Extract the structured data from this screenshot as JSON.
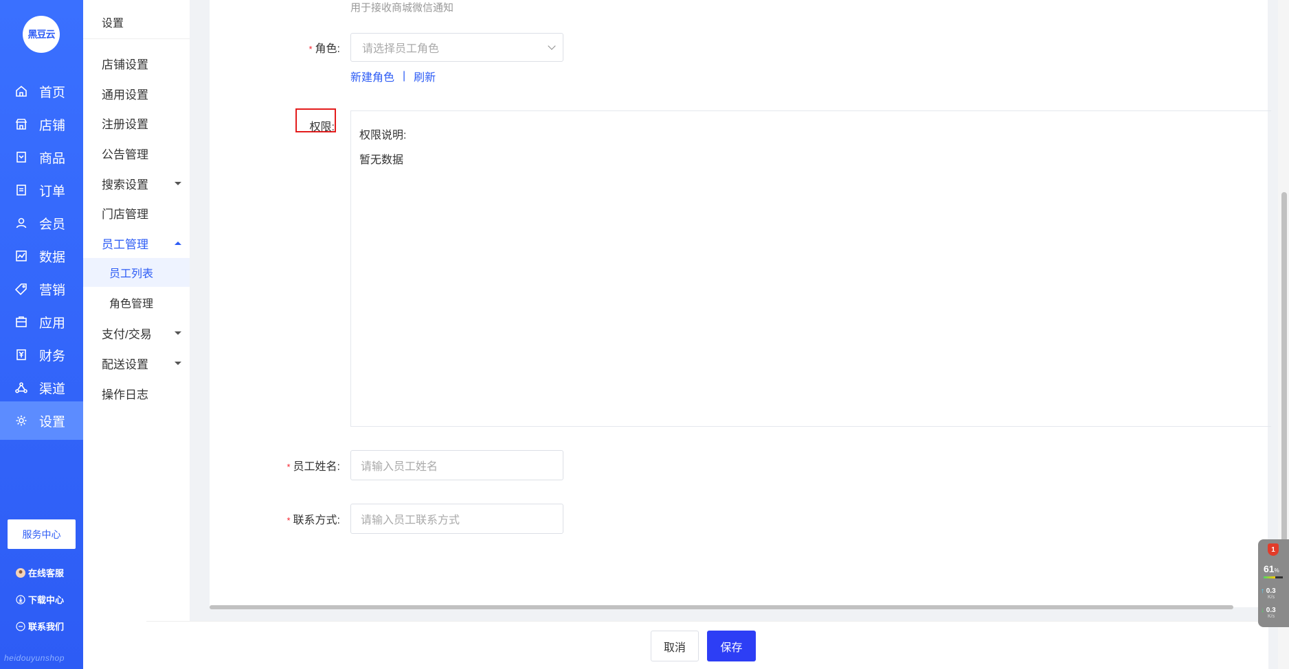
{
  "brand": {
    "logo_text": "黑豆云",
    "footer_text": "heidouyunshop"
  },
  "nav": [
    {
      "label": "首页",
      "icon": "home-icon"
    },
    {
      "label": "店铺",
      "icon": "store-icon"
    },
    {
      "label": "商品",
      "icon": "product-icon"
    },
    {
      "label": "订单",
      "icon": "order-icon"
    },
    {
      "label": "会员",
      "icon": "member-icon"
    },
    {
      "label": "数据",
      "icon": "data-icon"
    },
    {
      "label": "营销",
      "icon": "tag-icon"
    },
    {
      "label": "应用",
      "icon": "app-icon"
    },
    {
      "label": "财务",
      "icon": "finance-icon"
    },
    {
      "label": "渠道",
      "icon": "channel-icon"
    },
    {
      "label": "设置",
      "icon": "gear-icon"
    }
  ],
  "service": {
    "center_label": "服务中心",
    "online_label": "在线客服",
    "download_label": "下载中心",
    "contact_label": "联系我们"
  },
  "submenu": {
    "title": "设置",
    "items": [
      "店铺设置",
      "通用设置",
      "注册设置",
      "公告管理",
      "搜索设置",
      "门店管理",
      "员工管理"
    ],
    "staff_children": [
      "员工列表",
      "角色管理"
    ],
    "more": [
      "支付/交易",
      "配送设置",
      "操作日志"
    ]
  },
  "form": {
    "wechat_hint": "用于接收商城微信通知",
    "role_label": "角色:",
    "role_placeholder": "请选择员工角色",
    "new_role_link": "新建角色",
    "link_separator": "|",
    "refresh_link": "刷新",
    "permission_label": "权限:",
    "permission_desc_title": "权限说明:",
    "permission_empty": "暂无数据",
    "name_label": "员工姓名:",
    "name_placeholder": "请输入员工姓名",
    "contact_label": "联系方式:",
    "contact_placeholder": "请输入员工联系方式",
    "required_mark": "*"
  },
  "footer": {
    "cancel_label": "取消",
    "save_label": "保存"
  },
  "widget": {
    "badge": "1",
    "percent": "61",
    "percent_unit": "%",
    "up_speed": "0.3",
    "down_speed": "0.3",
    "speed_unit": "K/s"
  },
  "colors": {
    "primary": "#2d5cf5",
    "save_button": "#2d3ef5",
    "required": "#f5222d",
    "highlight_border": "#e31b1b"
  }
}
